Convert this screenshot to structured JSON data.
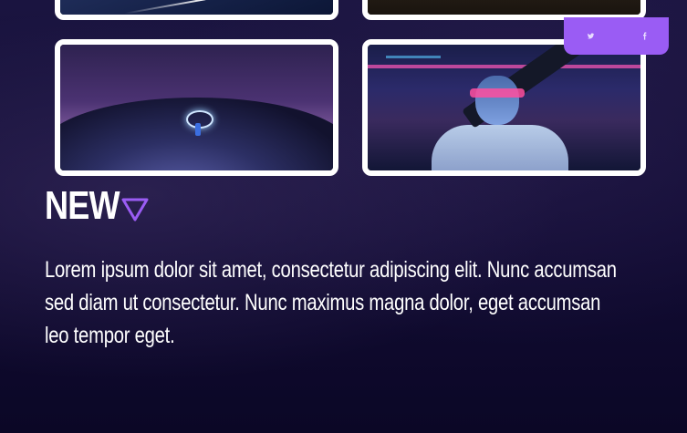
{
  "gallery": {
    "items": [
      {
        "alt": "night sky with shooting star"
      },
      {
        "alt": "dark scene"
      },
      {
        "alt": "light painting on snowy hill under starry sky"
      },
      {
        "alt": "cyberpunk figure with pink visor holding a large weapon"
      }
    ]
  },
  "social": {
    "icons": [
      "twitter-icon",
      "facebook-icon"
    ],
    "twitter_glyph": "𝕥",
    "facebook_glyph": "f",
    "background": "#9a5cf4"
  },
  "section": {
    "heading": "NEW",
    "accent_color": "#9a5cf4",
    "body": "Lorem ipsum dolor sit amet, consectetur adipiscing elit. Nunc accumsan sed diam ut consectetur. Nunc maximus magna dolor, eget accumsan leo tempor eget."
  }
}
